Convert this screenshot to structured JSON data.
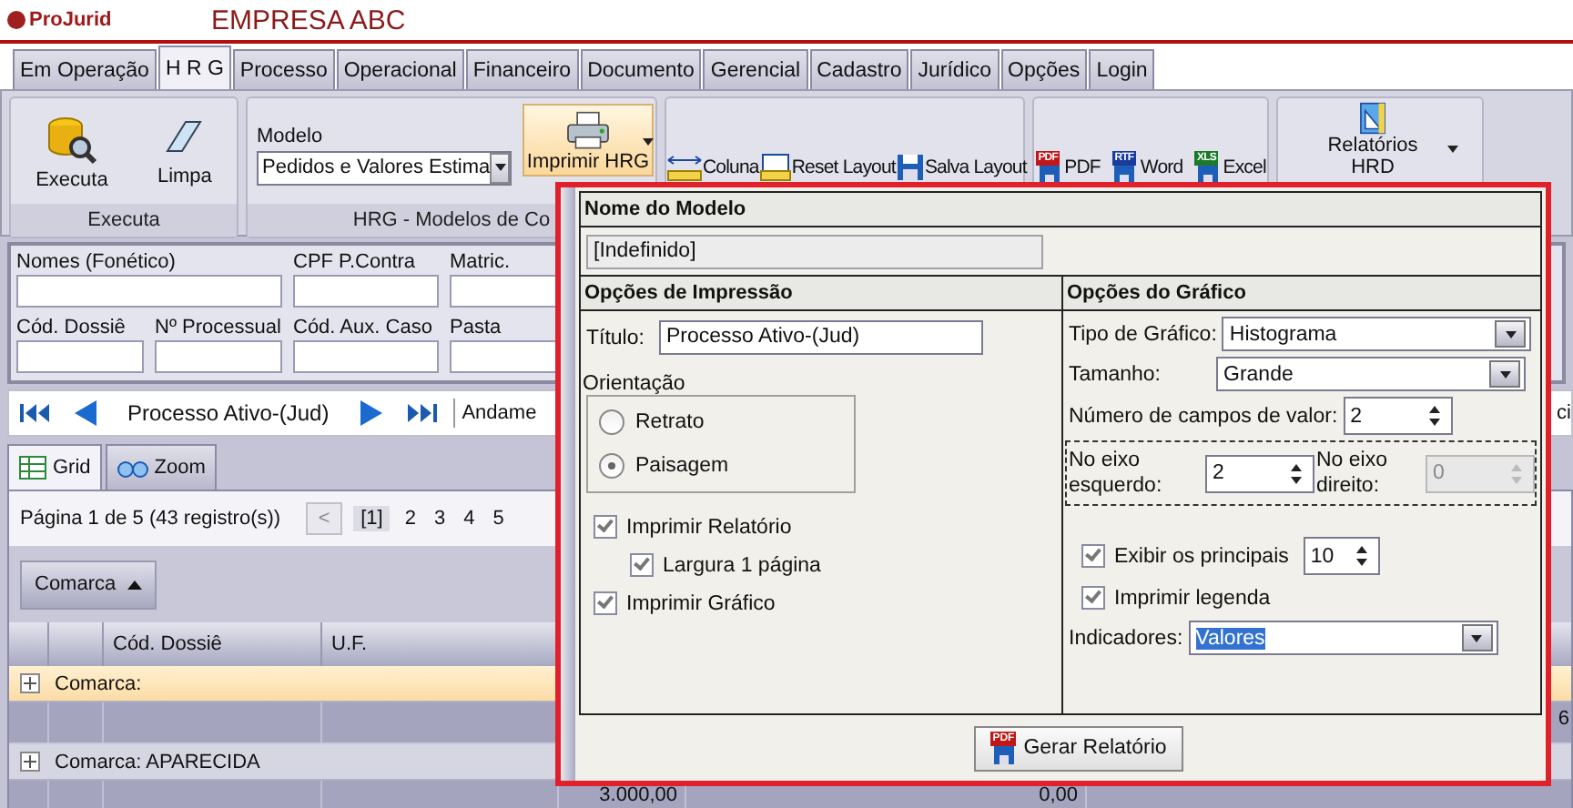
{
  "header": {
    "logo": "ProJurid",
    "company": "EMPRESA ABC"
  },
  "tabs": [
    {
      "label": "Em Operação",
      "selected": false
    },
    {
      "label": "H R G",
      "selected": true
    },
    {
      "label": "Processo",
      "selected": false
    },
    {
      "label": "Operacional",
      "selected": false
    },
    {
      "label": "Financeiro",
      "selected": false
    },
    {
      "label": "Documento",
      "selected": false
    },
    {
      "label": "Gerencial",
      "selected": false
    },
    {
      "label": "Cadastro",
      "selected": false
    },
    {
      "label": "Jurídico",
      "selected": false
    },
    {
      "label": "Opções",
      "selected": false
    },
    {
      "label": "Login",
      "selected": false
    }
  ],
  "ribbon": {
    "executa": {
      "buttons": [
        {
          "label": "Executa",
          "kind": "execute"
        },
        {
          "label": "Limpa",
          "kind": "eraser"
        }
      ],
      "caption": "Executa"
    },
    "modelo": {
      "label": "Modelo",
      "value": "Pedidos e Valores Estima",
      "print_button": "Imprimir HRG",
      "caption": "HRG - Modelos de Co"
    },
    "layout_buttons": [
      {
        "label": "Coluna",
        "kind": "column"
      },
      {
        "label": "Reset Layout",
        "kind": "reset"
      },
      {
        "label": "Salva Layout",
        "kind": "save"
      }
    ],
    "export_buttons": [
      {
        "label": "PDF",
        "badge": "PDF",
        "color": "#c01818"
      },
      {
        "label": "Word",
        "badge": "RTF",
        "color": "#1a3c9c"
      },
      {
        "label": "Excel",
        "badge": "XLS",
        "color": "#1a7a2a"
      }
    ],
    "reports_button": "Relatórios HRD"
  },
  "filters": {
    "row_1": [
      {
        "label": "Nomes (Fonético)"
      },
      {
        "label": "CPF P.Contra"
      },
      {
        "label": "Matric."
      }
    ],
    "row_2": [
      {
        "label": "Cód. Dossiê"
      },
      {
        "label": "Nº Processual"
      },
      {
        "label": "Cód. Aux. Caso"
      },
      {
        "label": "Pasta"
      }
    ]
  },
  "nav": {
    "title": "Processo Ativo-(Jud)",
    "next_tab": "Andame",
    "right_fragment": "ci"
  },
  "view_tabs": [
    {
      "label": "Grid",
      "selected": true
    },
    {
      "label": "Zoom",
      "selected": false
    }
  ],
  "pager": {
    "summary": "Página 1 de 5 (43 registro(s))",
    "prev": "<",
    "pages": [
      {
        "label": "[1]",
        "selected": true
      },
      {
        "label": "2",
        "selected": false
      },
      {
        "label": "3",
        "selected": false
      },
      {
        "label": "4",
        "selected": false
      },
      {
        "label": "5",
        "selected": false
      }
    ]
  },
  "group_by": {
    "label": "Comarca"
  },
  "table": {
    "columns": [
      "Cód. Dossiê",
      "U.F."
    ],
    "rows": [
      {
        "kind": "group",
        "label": "Comarca:",
        "selected": true
      },
      {
        "kind": "data",
        "right_value": "6"
      },
      {
        "kind": "group",
        "label": "Comarca: APARECIDA",
        "selected": false
      },
      {
        "kind": "data",
        "values": [
          "3.000,00",
          "0,00"
        ]
      }
    ]
  },
  "dialog": {
    "model_name": {
      "heading": "Nome do Modelo",
      "value": "[Indefinido]"
    },
    "print_options": {
      "heading": "Opções de Impressão",
      "title_label": "Título:",
      "title_value": "Processo Ativo-(Jud)",
      "orientation_label": "Orientação",
      "orientations": [
        {
          "label": "Retrato",
          "selected": false
        },
        {
          "label": "Paisagem",
          "selected": true
        }
      ],
      "checks": [
        {
          "label": "Imprimir Relatório",
          "checked": true,
          "children": [
            {
              "label": "Largura 1 página",
              "checked": true
            }
          ]
        },
        {
          "label": "Imprimir Gráfico",
          "checked": true
        }
      ]
    },
    "chart_options": {
      "heading": "Opções do Gráfico",
      "fields": [
        {
          "kind": "select",
          "label": "Tipo de Gráfico:",
          "value": "Histograma"
        },
        {
          "kind": "select",
          "label": "Tamanho:",
          "value": "Grande"
        },
        {
          "kind": "spin",
          "label": "Número de campos de valor:",
          "value": "2"
        }
      ],
      "axes": [
        {
          "label": "No eixo esquerdo:",
          "value": "2",
          "disabled": false
        },
        {
          "label": "No eixo direito:",
          "value": "0",
          "disabled": true
        }
      ],
      "checks": [
        {
          "label": "Exibir os principais",
          "checked": true,
          "value": "10"
        },
        {
          "label": "Imprimir legenda",
          "checked": true
        }
      ],
      "indicators": {
        "label": "Indicadores:",
        "value": "Valores"
      }
    },
    "button": "Gerar Relatório",
    "button_badge": "PDF"
  }
}
